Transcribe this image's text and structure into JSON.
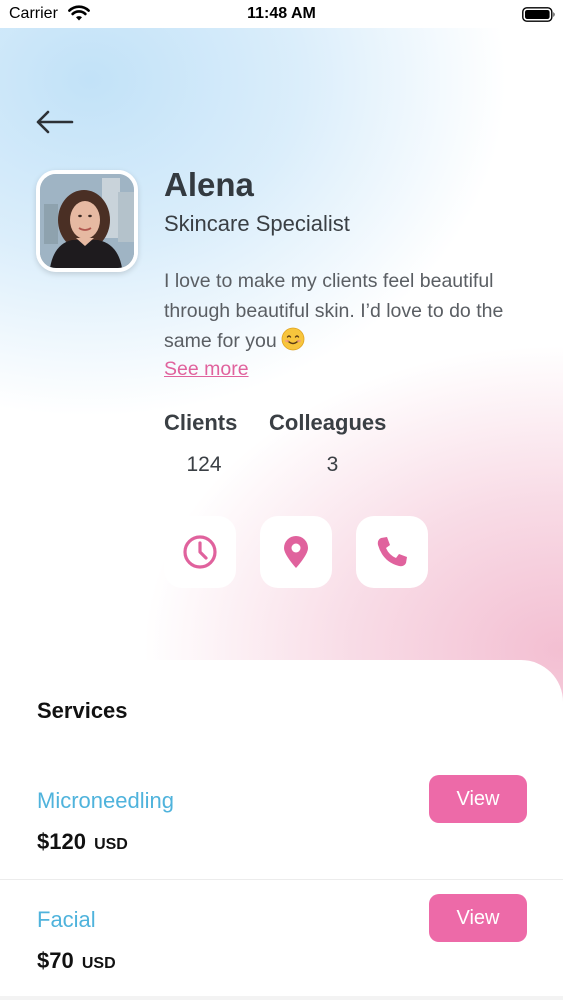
{
  "status_bar": {
    "carrier": "Carrier",
    "time": "11:48 AM"
  },
  "profile": {
    "name": "Alena",
    "role": "Skincare Specialist",
    "bio": "I love to make my clients feel beautiful through beautiful skin. I’d love to do the same for you",
    "see_more": "See more"
  },
  "stats": [
    {
      "label": "Clients",
      "value": "124"
    },
    {
      "label": "Colleagues",
      "value": "3"
    }
  ],
  "actions": [
    {
      "icon": "clock-icon"
    },
    {
      "icon": "location-pin-icon"
    },
    {
      "icon": "phone-icon"
    }
  ],
  "services": {
    "title": "Services",
    "items": [
      {
        "name": "Microneedling",
        "price": "$120",
        "currency": "USD",
        "button": "View"
      },
      {
        "name": "Facial",
        "price": "$70",
        "currency": "USD",
        "button": "View"
      }
    ]
  },
  "colors": {
    "accent_pink": "#ed6aa8",
    "service_blue": "#4fb3dc",
    "text_dark": "#333a40"
  }
}
